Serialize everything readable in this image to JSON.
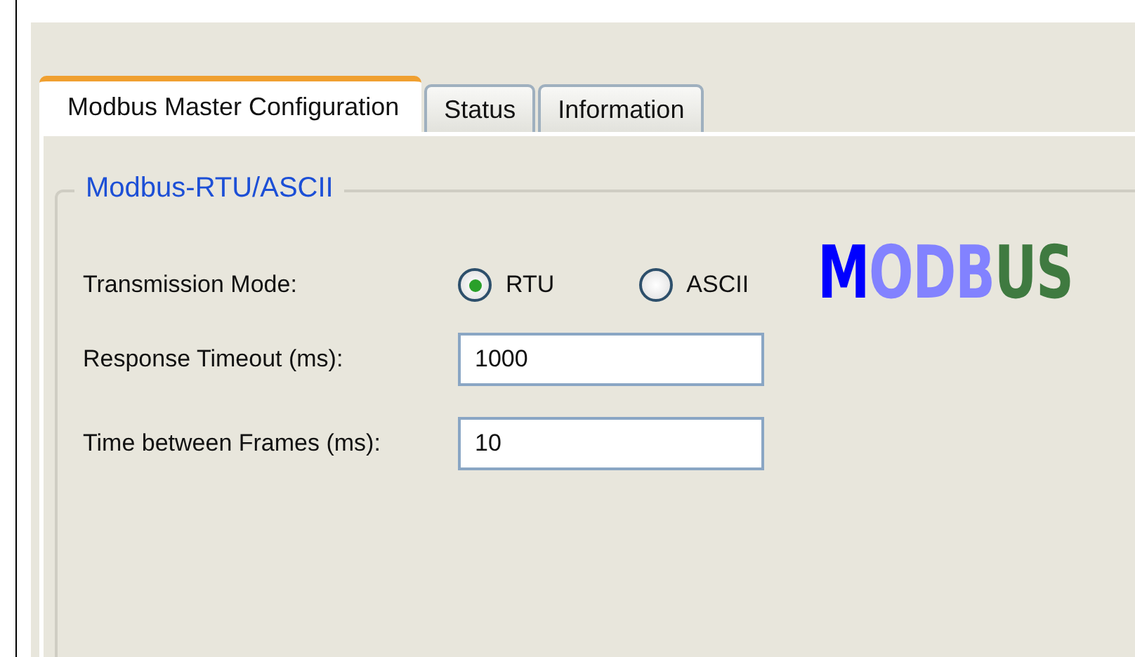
{
  "tabs": [
    {
      "label": "Modbus Master Configuration",
      "selected": true
    },
    {
      "label": "Status",
      "selected": false
    },
    {
      "label": "Information",
      "selected": false
    }
  ],
  "group": {
    "title": "Modbus-RTU/ASCII",
    "logo": [
      {
        "text": "M",
        "color": "#0000ff"
      },
      {
        "text": "ODB",
        "color": "#8282ff"
      },
      {
        "text": "US",
        "color": "#3f7a40"
      }
    ],
    "transmission_mode": {
      "label": "Transmission Mode:",
      "options": [
        {
          "label": "RTU",
          "selected": true
        },
        {
          "label": "ASCII",
          "selected": false
        }
      ]
    },
    "fields": [
      {
        "label": "Response Timeout (ms):",
        "value": "1000"
      },
      {
        "label": "Time between Frames (ms):",
        "value": "10"
      }
    ]
  }
}
